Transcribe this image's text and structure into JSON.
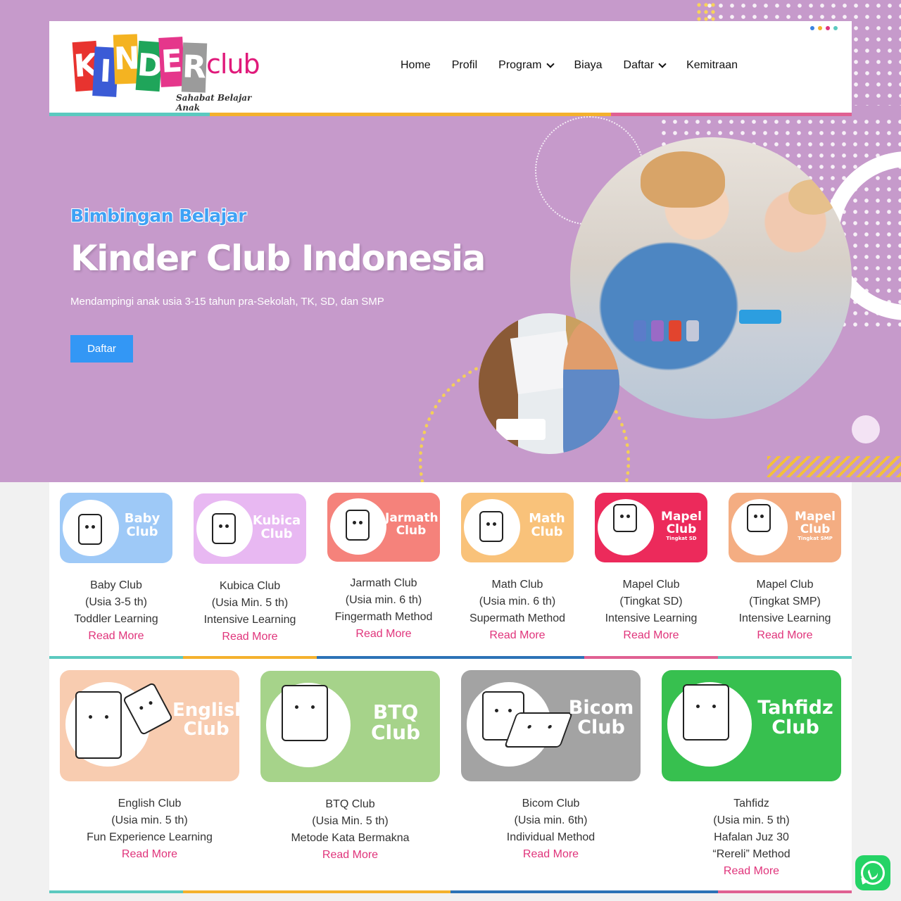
{
  "header": {
    "logo": {
      "letters": [
        "K",
        "I",
        "N",
        "D",
        "E",
        "R"
      ],
      "letter_colors": [
        "#e8332f",
        "#3b5bd6",
        "#f4b321",
        "#1fa55a",
        "#e5368b",
        "#9b9b9b"
      ],
      "suffix": "club",
      "tagline": "Sahabat Belajar Anak"
    },
    "nav": [
      {
        "label": "Home",
        "dropdown": false
      },
      {
        "label": "Profil",
        "dropdown": false
      },
      {
        "label": "Program",
        "dropdown": true
      },
      {
        "label": "Biaya",
        "dropdown": false
      },
      {
        "label": "Daftar",
        "dropdown": true
      },
      {
        "label": "Kemitraan",
        "dropdown": false
      }
    ],
    "accent_bar_colors": [
      "#5bc9bf",
      "#f4b12d",
      "#e06092"
    ],
    "menu_dot_colors": [
      "#3a83e0",
      "#f4b12d",
      "#e0347b",
      "#5bc9bf"
    ]
  },
  "hero": {
    "kicker": "Bimbingan Belajar",
    "title": "Kinder Club Indonesia",
    "subtitle": "Mendampingi anak usia 3-15 tahun pra-Sekolah, TK, SD, dan SMP",
    "cta_label": "Daftar",
    "background_color": "#c69acb",
    "cta_color": "#3397f5"
  },
  "programs_row1": [
    {
      "tile_title": "Baby Club",
      "tile_sub": "",
      "tile_color": "#9ec9f7",
      "lines": [
        "Baby Club",
        "(Usia 3-5 th)",
        "Toddler Learning"
      ],
      "link": "Read More"
    },
    {
      "tile_title": "Kubica Club",
      "tile_sub": "",
      "tile_color": "#e8b8f2",
      "lines": [
        "Kubica Club",
        "(Usia Min. 5 th)",
        "Intensive Learning"
      ],
      "link": "Read More"
    },
    {
      "tile_title": "Jarmath Club",
      "tile_sub": "",
      "tile_color": "#f5827b",
      "lines": [
        "Jarmath Club",
        "(Usia min. 6 th)",
        "Fingermath Method"
      ],
      "link": "Read More"
    },
    {
      "tile_title": "Math Club",
      "tile_sub": "",
      "tile_color": "#f9c27a",
      "lines": [
        "Math Club",
        "(Usia min. 6 th)",
        "Supermath Method"
      ],
      "link": "Read More"
    },
    {
      "tile_title": "Mapel Club",
      "tile_sub": "Tingkat SD",
      "tile_color": "#ec2a5b",
      "lines": [
        "Mapel Club",
        "(Tingkat SD)",
        "Intensive Learning"
      ],
      "link": "Read More"
    },
    {
      "tile_title": "Mapel Club",
      "tile_sub": "Tingkat SMP",
      "tile_color": "#f4ad82",
      "lines": [
        "Mapel Club",
        "(Tingkat SMP)",
        "Intensive Learning"
      ],
      "link": "Read More"
    }
  ],
  "programs_row2": [
    {
      "tile_title": "English Club",
      "tile_sub": "",
      "tile_color": "#f8ccb0",
      "lines": [
        "English Club",
        "(Usia min. 5 th)",
        "Fun Experience Learning"
      ],
      "link": "Read More"
    },
    {
      "tile_title": "BTQ Club",
      "tile_sub": "",
      "tile_color": "#a6d38a",
      "lines": [
        "BTQ Club",
        "(Usia Min. 5 th)",
        "Metode Kata Bermakna"
      ],
      "link": "Read More"
    },
    {
      "tile_title": "Bicom Club",
      "tile_sub": "",
      "tile_color": "#a3a3a3",
      "lines": [
        "Bicom Club",
        "(Usia min. 6th)",
        "Individual Method"
      ],
      "link": "Read More"
    },
    {
      "tile_title": "Tahfidz Club",
      "tile_sub": "",
      "tile_color": "#37c04f",
      "lines": [
        "Tahfidz",
        "(Usia min. 5 th)",
        "Hafalan Juz 30",
        "“Rereli” Method"
      ],
      "link": "Read More"
    }
  ],
  "divider_colors": [
    "#5bc9bf",
    "#f4b12d",
    "#2c72b6",
    "#e06092",
    "#5bc9bf"
  ],
  "whatsapp": {
    "icon": "whatsapp-icon",
    "color": "#25d366"
  }
}
